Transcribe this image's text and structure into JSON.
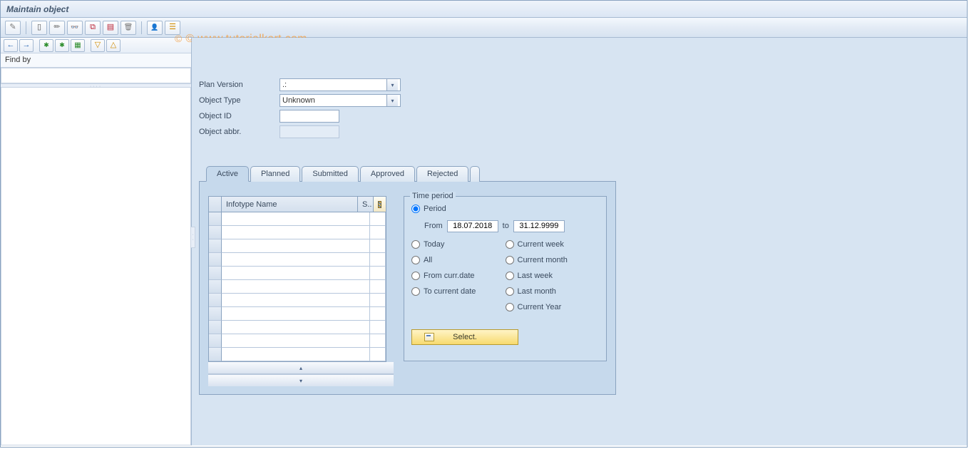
{
  "title": "Maintain object",
  "watermark": "© www.tutorialkart.com",
  "apptoolbar": {
    "icons": [
      {
        "name": "pencil-icon"
      },
      {
        "sep": true
      },
      {
        "name": "page-icon"
      },
      {
        "name": "pencil2-icon"
      },
      {
        "name": "glasses-icon"
      },
      {
        "name": "copy-icon"
      },
      {
        "name": "delimit-icon"
      },
      {
        "name": "trash-icon"
      },
      {
        "sep": true
      },
      {
        "name": "person-icon"
      },
      {
        "name": "hier-icon"
      }
    ]
  },
  "leftpane": {
    "mini_icons": [
      "left",
      "right",
      "sep",
      "star",
      "star",
      "stargrid",
      "sep",
      "expand",
      "collapse"
    ],
    "findby_label": "Find by"
  },
  "fields": {
    "plan_version": {
      "label": "Plan Version",
      "value": ".:"
    },
    "object_type": {
      "label": "Object Type",
      "value": "Unknown"
    },
    "object_id": {
      "label": "Object ID",
      "value": ""
    },
    "object_abbr": {
      "label": "Object abbr.",
      "value": ""
    }
  },
  "tabs": [
    "Active",
    "Planned",
    "Submitted",
    "Approved",
    "Rejected"
  ],
  "active_tab_index": 0,
  "table": {
    "col_name": "Infotype Name",
    "col_s": "S..",
    "row_count": 11
  },
  "timeperiod": {
    "group_title": "Time period",
    "options": {
      "period": "Period",
      "today": "Today",
      "all": "All",
      "from_curr": "From curr.date",
      "to_curr": "To current date",
      "curr_week": "Current week",
      "curr_month": "Current month",
      "last_week": "Last week",
      "last_month": "Last month",
      "curr_year": "Current Year"
    },
    "from_label": "From",
    "to_label": "to",
    "from_value": "18.07.2018",
    "to_value": "31.12.9999",
    "selected": "period",
    "select_button": "Select."
  }
}
